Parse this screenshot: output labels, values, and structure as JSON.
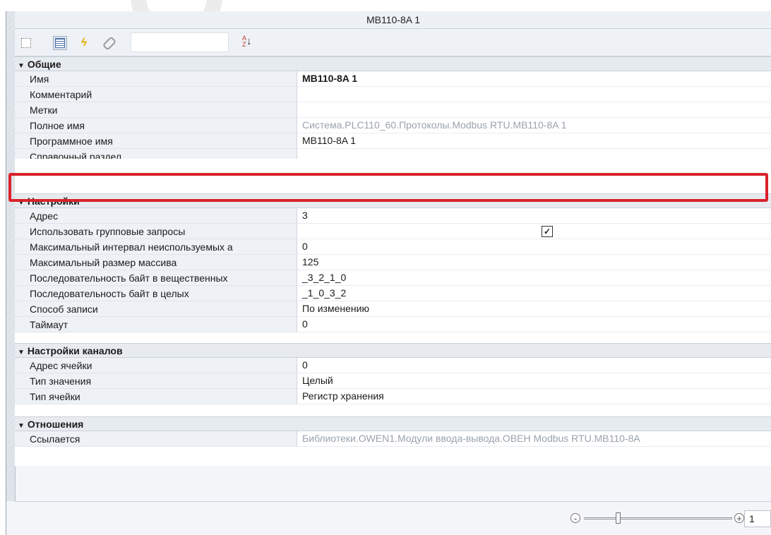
{
  "window": {
    "title": "MB110-8A 1"
  },
  "toolbar": {
    "buttons": [
      {
        "icon": "categorized-view-icon"
      },
      {
        "icon": "alphabetical-list-icon"
      },
      {
        "icon": "events-lightning-icon"
      },
      {
        "icon": "link-icon"
      }
    ],
    "search_value": "",
    "sort_label": "A Z"
  },
  "grid": {
    "categories": [
      {
        "label": "Общие",
        "rows": [
          {
            "name": "Имя",
            "value": "MB110-8A 1",
            "style": "bold"
          },
          {
            "name": "Комментарий",
            "value": ""
          },
          {
            "name": "Метки",
            "value": ""
          },
          {
            "name": "Полное имя",
            "value": "Система.PLC110_60.Протоколы.Modbus RTU.MB110-8A 1",
            "style": "grey"
          },
          {
            "name": "Программное имя",
            "value": "MB110-8A 1"
          },
          {
            "name": "Справочный раздел",
            "value": ""
          }
        ]
      },
      {
        "label": "Настройки",
        "rows": [
          {
            "name": "Адрес",
            "value": "3"
          },
          {
            "name": "Использовать групповые запросы",
            "value": "",
            "checked": true
          },
          {
            "name": "Максимальный интервал неиспользуемых а",
            "value": "0"
          },
          {
            "name": "Максимальный размер массива",
            "value": "125"
          },
          {
            "name": "Последовательность байт в вещественных",
            "value": "_3_2_1_0"
          },
          {
            "name": "Последовательность байт в целых",
            "value": "_1_0_3_2"
          },
          {
            "name": "Способ записи",
            "value": "По изменению"
          },
          {
            "name": "Таймаут",
            "value": "0"
          }
        ]
      },
      {
        "label": "Настройки каналов",
        "rows": [
          {
            "name": "Адрес ячейки",
            "value": "0"
          },
          {
            "name": "Тип значения",
            "value": "Целый"
          },
          {
            "name": "Тип ячейки",
            "value": "Регистр хранения"
          }
        ]
      },
      {
        "label": "Отношения",
        "rows": [
          {
            "name": "Ссылается",
            "value": "Библиотеки.OWEN1.Модули ввода-вывода.ОВЕН Modbus RTU.MB110-8A",
            "style": "grey"
          }
        ]
      }
    ]
  },
  "zoom": {
    "minus": "-",
    "plus": "+",
    "value": "1"
  },
  "colors": {
    "highlight": "#d8232a",
    "category_bg": "#e7ebf0",
    "name_col_bg": "#eef1f5"
  }
}
